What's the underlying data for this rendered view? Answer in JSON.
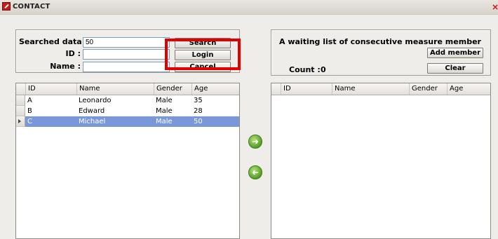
{
  "window": {
    "title": "CONTACT",
    "close_glyph": "×"
  },
  "search_panel": {
    "searched_label": "Searched data :",
    "searched_value": "50",
    "id_label": "ID :",
    "id_value": "",
    "name_label": "Name :",
    "name_value": "",
    "search_button": "Search",
    "login_button": "Login",
    "cancel_button": "Cancel"
  },
  "waiting_panel": {
    "heading": "A waiting list of consecutive measure member",
    "add_button": "Add member",
    "clear_button": "Clear",
    "count_label": "Count :",
    "count_value": "0"
  },
  "left_grid": {
    "columns": [
      "ID",
      "Name",
      "Gender",
      "Age"
    ],
    "rows": [
      {
        "id": "A",
        "name": "Leonardo",
        "gender": "Male",
        "age": "35"
      },
      {
        "id": "B",
        "name": "Edward",
        "gender": "Male",
        "age": "28"
      },
      {
        "id": "C",
        "name": "Michael",
        "gender": "Male",
        "age": "50"
      }
    ],
    "selected_row": 2
  },
  "right_grid": {
    "columns": [
      "ID",
      "Name",
      "Gender",
      "Age"
    ]
  },
  "icons": {
    "move_right": "arrow-right-circle-icon",
    "move_left": "arrow-left-circle-icon",
    "highlight_color": "#e00000",
    "selected_row_color": "#7a98d9"
  }
}
